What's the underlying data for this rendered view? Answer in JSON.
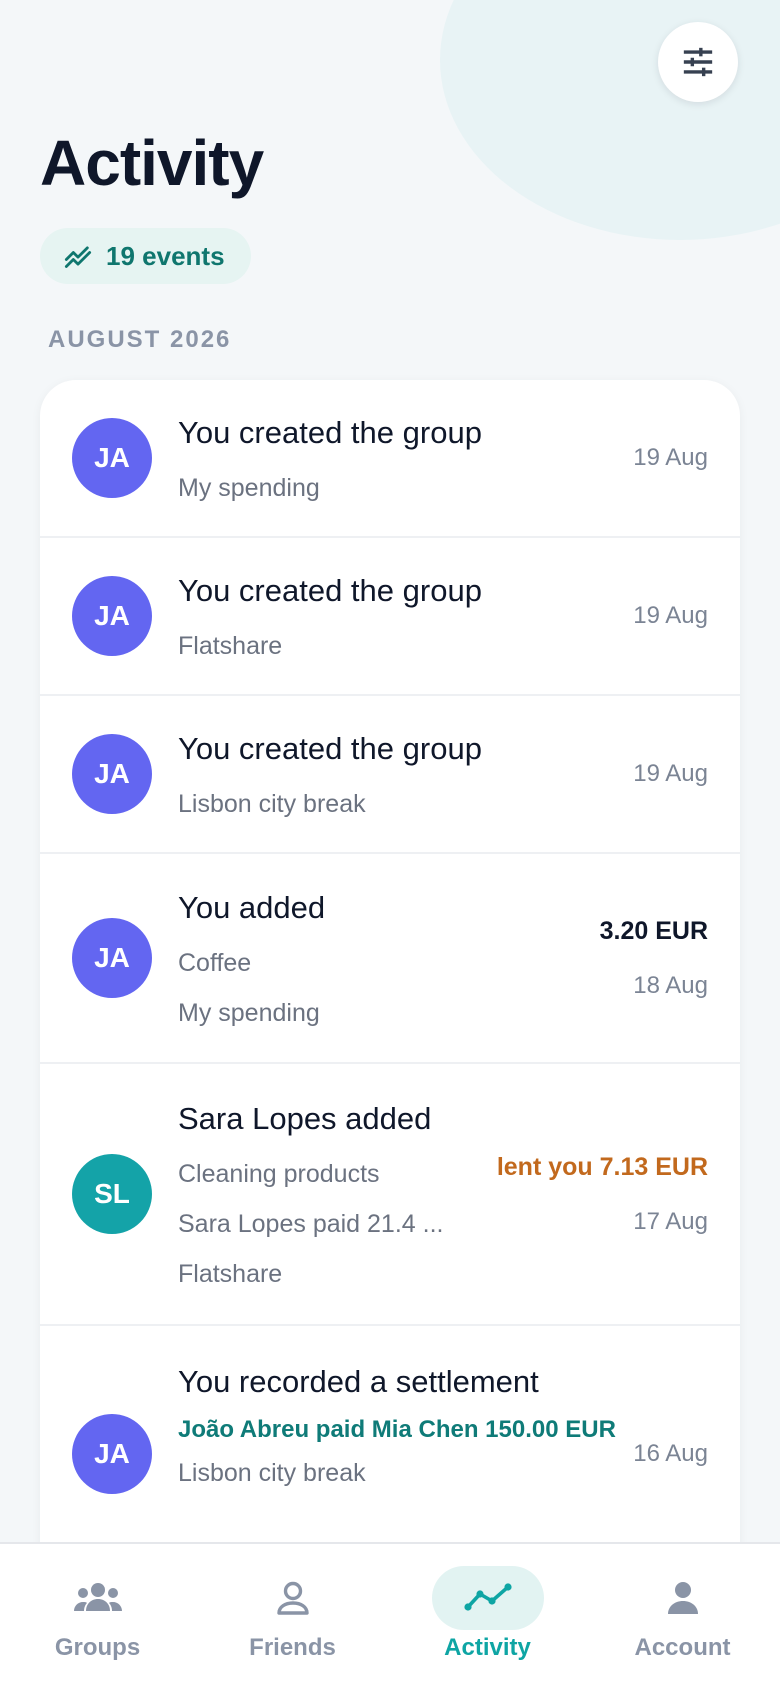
{
  "header": {
    "title": "Activity",
    "events_count": "19 events",
    "filter_icon": "sliders-icon"
  },
  "section": {
    "label": "AUGUST 2026"
  },
  "activities": [
    {
      "initials": "JA",
      "title": "You created the group",
      "lines": [
        "My spending"
      ],
      "date": "19 Aug"
    },
    {
      "initials": "JA",
      "title": "You created the group",
      "lines": [
        "Flatshare"
      ],
      "date": "19 Aug"
    },
    {
      "initials": "JA",
      "title": "You created the group",
      "lines": [
        "Lisbon city break"
      ],
      "date": "19 Aug"
    },
    {
      "initials": "JA",
      "title": "You added",
      "lines": [
        "Coffee",
        "My spending"
      ],
      "amount": "3.20 EUR",
      "date": "18 Aug"
    },
    {
      "initials": "SL",
      "title": "Sara Lopes added",
      "lines": [
        "Cleaning products",
        "Sara Lopes paid 21.4 ...",
        "Flatshare"
      ],
      "status": "lent you 7.13 EUR",
      "date": "17 Aug"
    },
    {
      "initials": "JA",
      "title": "You recorded a settlement",
      "detail": "João Abreu paid Mia Chen 150.00 EUR",
      "lines": [
        "Lisbon city break"
      ],
      "date": "16 Aug"
    }
  ],
  "nav": [
    {
      "label": "Groups",
      "icon": "groups-icon",
      "active": false
    },
    {
      "label": "Friends",
      "icon": "person-icon",
      "active": false
    },
    {
      "label": "Activity",
      "icon": "trend-line-icon",
      "active": true
    },
    {
      "label": "Account",
      "icon": "account-icon",
      "active": false
    }
  ],
  "colors": {
    "accent_teal": "#0ea5a4",
    "avatar_indigo": "#6366f1",
    "avatar_teal": "#14a3a8",
    "lent_orange": "#c2691d",
    "settlement_teal": "#0f7b78"
  }
}
